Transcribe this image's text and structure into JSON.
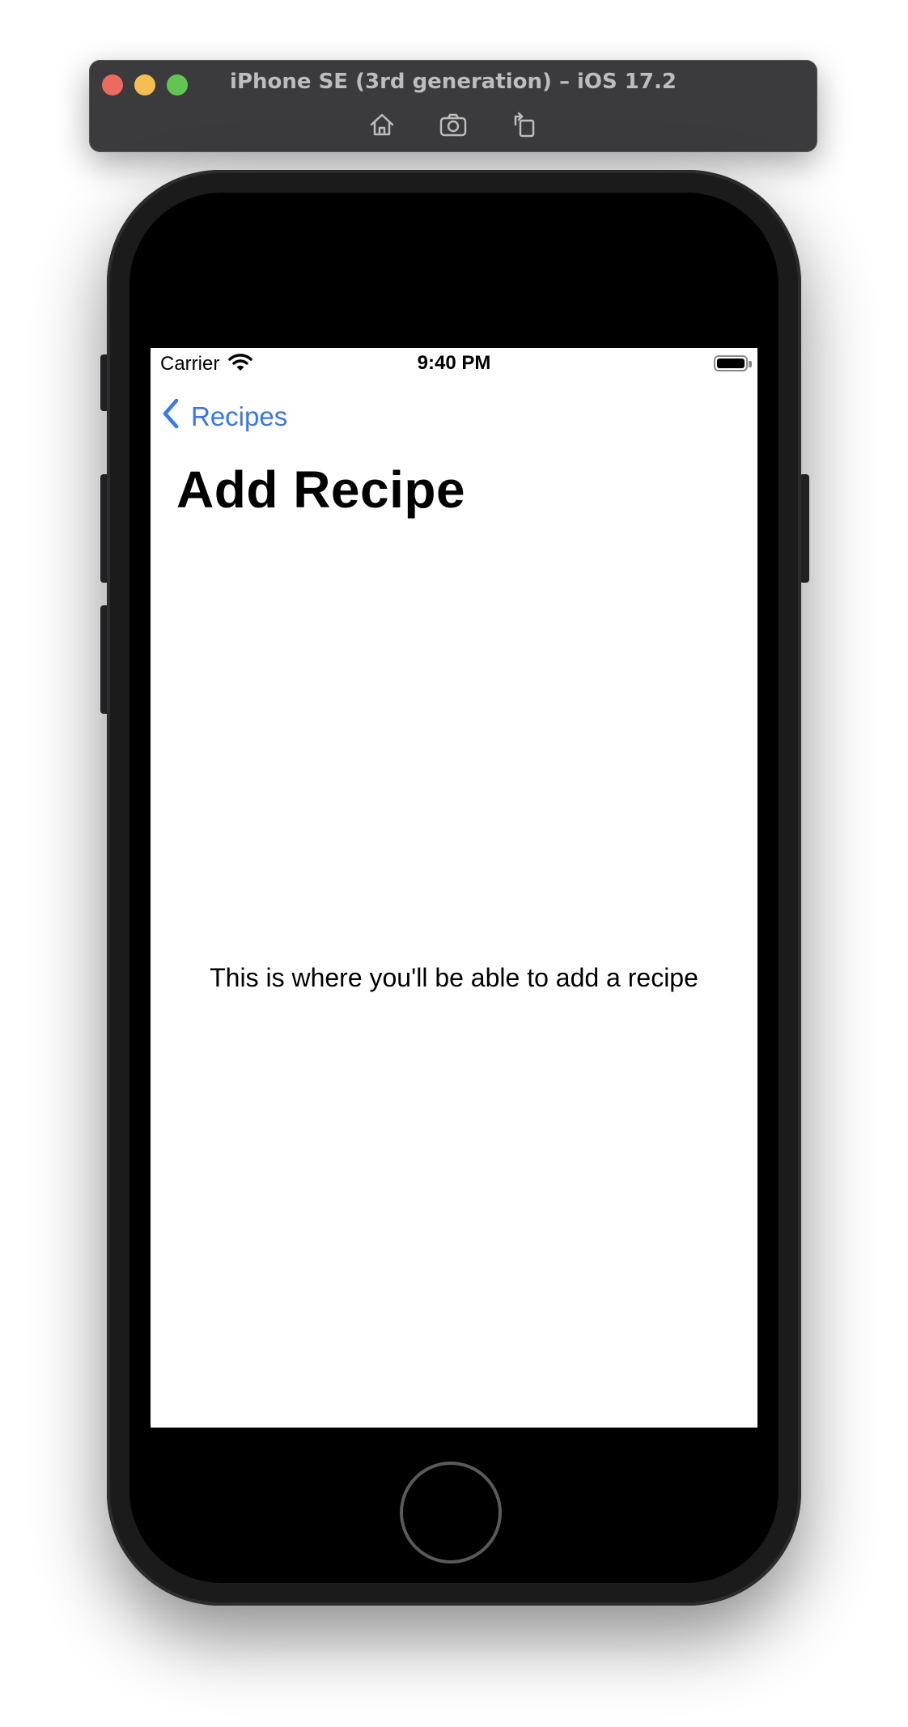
{
  "simulator": {
    "title": "iPhone SE (3rd generation) – iOS 17.2",
    "tools": [
      {
        "name": "home-icon"
      },
      {
        "name": "screenshot-icon"
      },
      {
        "name": "rotate-icon"
      }
    ]
  },
  "status_bar": {
    "carrier": "Carrier",
    "time": "9:40 PM"
  },
  "nav": {
    "back_label": "Recipes",
    "title": "Add Recipe"
  },
  "content": {
    "message": "This is where you'll be able to add a recipe"
  },
  "colors": {
    "accent": "#3478f6",
    "screen_background": "#ffffff",
    "device_frame": "#1b1b1c"
  }
}
